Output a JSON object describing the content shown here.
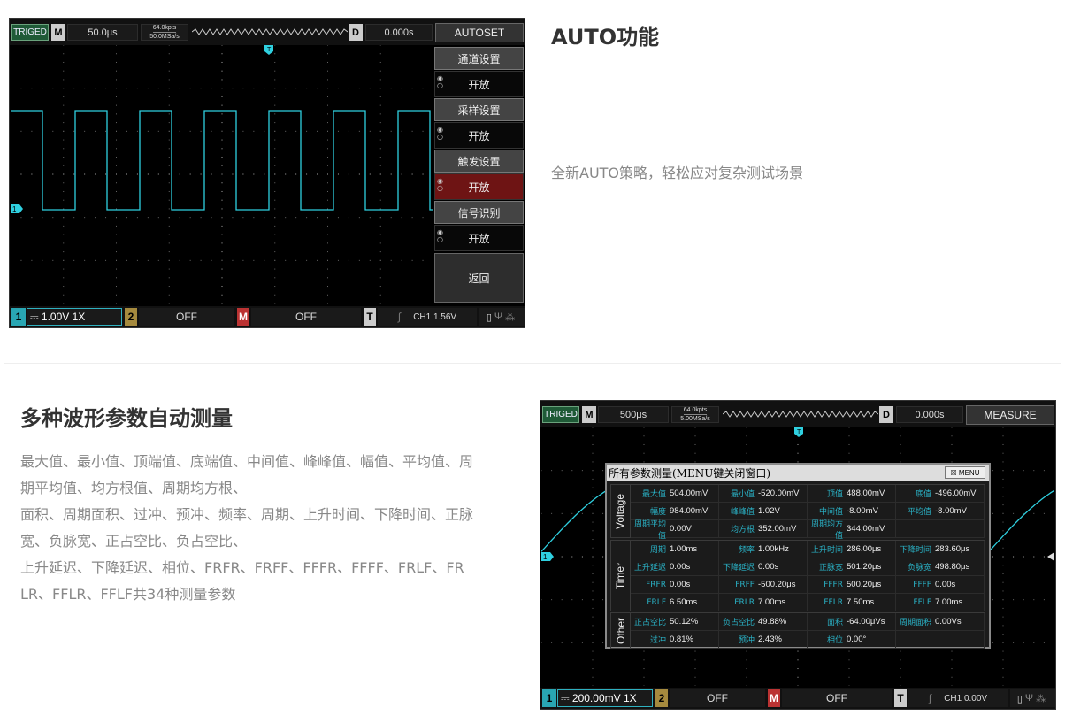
{
  "section1": {
    "title": "AUTO功能",
    "desc": "全新AUTO策略，轻松应对复杂测试场景"
  },
  "section2": {
    "title": "多种波形参数自动测量",
    "lines": [
      "最大值、最小值、顶端值、底端值、中间值、峰峰值、幅值、平均值、周",
      "期平均值、均方根值、周期均方根、",
      "面积、周期面积、过冲、预冲、频率、周期、上升时间、下降时间、正脉",
      "宽、负脉宽、正占空比、负占空比、",
      "上升延迟、下降延迟、相位、FRFR、FRFF、FFFR、FFFF、FRLF、FR",
      "LR、FFLR、FFLF共34种测量参数"
    ]
  },
  "scope1": {
    "trig_status": "TRIGED",
    "m_label": "M",
    "timebase": "50.0μs",
    "depth": "64.0kpts",
    "samplerate": "50.0MSa/s",
    "d_label": "D",
    "delay": "0.000s",
    "mode_button": "AUTOSET",
    "menu": [
      {
        "title": "通道设置",
        "value": "开放"
      },
      {
        "title": "采样设置",
        "value": "开放"
      },
      {
        "title": "触发设置",
        "value": "开放"
      },
      {
        "title": "信号识别",
        "value": "开放"
      }
    ],
    "back": "返回",
    "ch1_num": "1",
    "ch1_scale": "⎓ 1.00V  1X",
    "ch2_num": "2",
    "ch2_state": "OFF",
    "math_num": "M",
    "math_state": "OFF",
    "trig_num": "T",
    "trig_info": "CH1  1.56V",
    "trace_color": "#2fd0e0"
  },
  "scope2": {
    "trig_status": "TRIGED",
    "m_label": "M",
    "timebase": "500μs",
    "depth": "64.0kpts",
    "samplerate": "5.00MSa/s",
    "d_label": "D",
    "delay": "0.000s",
    "mode_button": "MEASURE",
    "ch1_num": "1",
    "ch1_scale": "⎓ 200.00mV  1X",
    "ch2_num": "2",
    "ch2_state": "OFF",
    "math_num": "M",
    "math_state": "OFF",
    "trig_num": "T",
    "trig_info": "CH1  0.00V",
    "table": {
      "title": "所有参数测量(MENU键关闭窗口)",
      "menu_btn": "☒  MENU",
      "voltage_label": "Voltage",
      "timer_label": "Timer",
      "other_label": "Other",
      "voltage": [
        [
          [
            "最大值",
            "504.00mV"
          ],
          [
            "最小值",
            "-520.00mV"
          ],
          [
            "顶值",
            "488.00mV"
          ],
          [
            "底值",
            "-496.00mV"
          ]
        ],
        [
          [
            "幅度",
            "984.00mV"
          ],
          [
            "峰峰值",
            "1.02V"
          ],
          [
            "中间值",
            "-8.00mV"
          ],
          [
            "平均值",
            "-8.00mV"
          ]
        ],
        [
          [
            "周期平均值",
            "0.00V"
          ],
          [
            "均方根",
            "352.00mV"
          ],
          [
            "周期均方值",
            "344.00mV"
          ],
          [
            "",
            ""
          ]
        ]
      ],
      "timer": [
        [
          [
            "周期",
            "1.00ms"
          ],
          [
            "频率",
            "1.00kHz"
          ],
          [
            "上升时间",
            "286.00μs"
          ],
          [
            "下降时间",
            "283.60μs"
          ]
        ],
        [
          [
            "上升延迟",
            "0.00s"
          ],
          [
            "下降延迟",
            "0.00s"
          ],
          [
            "正脉宽",
            "501.20μs"
          ],
          [
            "负脉宽",
            "498.80μs"
          ]
        ],
        [
          [
            "FRFR",
            "0.00s"
          ],
          [
            "FRFF",
            "-500.20μs"
          ],
          [
            "FFFR",
            "500.20μs"
          ],
          [
            "FFFF",
            "0.00s"
          ]
        ],
        [
          [
            "FRLF",
            "6.50ms"
          ],
          [
            "FRLR",
            "7.00ms"
          ],
          [
            "FFLR",
            "7.50ms"
          ],
          [
            "FFLF",
            "7.00ms"
          ]
        ]
      ],
      "other": [
        [
          [
            "正占空比",
            "50.12%"
          ],
          [
            "负占空比",
            "49.88%"
          ],
          [
            "面积",
            "-64.00μVs"
          ],
          [
            "周期面积",
            "0.00Vs"
          ]
        ],
        [
          [
            "过冲",
            "0.81%"
          ],
          [
            "预冲",
            "2.43%"
          ],
          [
            "相位",
            "0.00°"
          ],
          [
            "",
            ""
          ]
        ]
      ]
    }
  }
}
